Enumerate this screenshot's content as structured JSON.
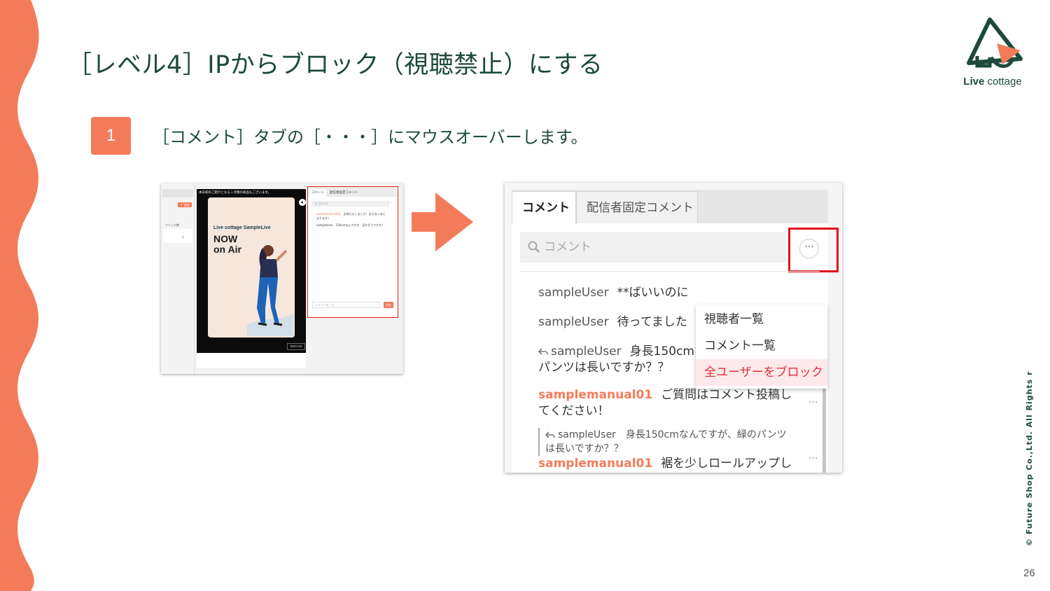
{
  "slide": {
    "title": "［レベル4］IPからブロック（視聴禁止）にする",
    "page_number": "26",
    "copyright": "© Future Shop Co.,Ltd. All Rights reserved.",
    "accent_color": "#f47b5a",
    "title_color": "#1d4a3c"
  },
  "logo": {
    "text_bold": "Live",
    "text_regular": " cottage"
  },
  "step": {
    "number": "1",
    "text": "［コメント］タブの［・・・］にマウスオーバーします。"
  },
  "small_screenshot": {
    "add_button": "＋ 追加",
    "click_label": "クリック数",
    "click_value": "1",
    "notice": "本日初のご紹介となる１点物の商品もございます。",
    "brand": "Live cottage SampleLive",
    "now_on_air": "NOW\non Air",
    "item_list_button": "Item list",
    "tabs": [
      "コメント",
      "配信者固定コメント"
    ],
    "search_placeholder": "コメント",
    "more": "···",
    "comments": [
      {
        "user": "samplemanual01",
        "text": "お待たせしました！まもなくはじまります！"
      },
      {
        "user": "sampleUser",
        "text": "150cmなんですが、足れそうですか？"
      }
    ],
    "input_placeholder": "コメントを入力",
    "send_button": "送信"
  },
  "big_screenshot": {
    "tabs": [
      "コメント",
      "配信者固定コメント"
    ],
    "search_placeholder": "コメント",
    "more_button": "···",
    "menu_items": [
      "視聴者一覧",
      "コメント一覧",
      "全ユーザーをブロック"
    ],
    "comments": [
      {
        "user": "sampleUser",
        "text": "**ばいいのに"
      },
      {
        "user": "sampleUser",
        "text": "待ってました"
      },
      {
        "user": "sampleUser",
        "text": "身長150cmなんですが、緑のパンツは長いですか？？"
      },
      {
        "user": "samplemanual01",
        "text": "ご質問はコメント投稿してください！"
      },
      {
        "user": "samplemanual01",
        "text": "裾を少しロールアップして"
      }
    ],
    "quote": {
      "user": "sampleUser",
      "text": "身長150cmなんですが、緑のパンツは長いですか？？"
    },
    "row_dots": "···"
  }
}
